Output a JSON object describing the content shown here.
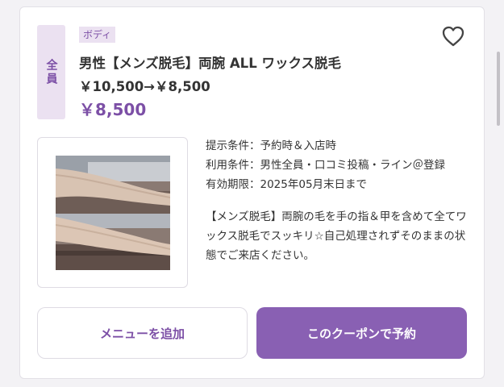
{
  "coupon": {
    "badge": "全員",
    "category": "ボディ",
    "title": "男性【メンズ脱毛】両腕 ALL ワックス脱毛￥10,500→￥8,500",
    "price": "￥8,500",
    "favorite_icon": "heart-outline-icon",
    "details": [
      {
        "label": "提示条件：",
        "value": "予約時＆入店時"
      },
      {
        "label": "利用条件：",
        "value": "男性全員・口コミ投稿・ライン＠登録"
      },
      {
        "label": "有効期限：",
        "value": "2025年05月末日まで"
      }
    ],
    "description": "【メンズ脱毛】両腕の毛を手の指＆甲を含めて全てワックス脱毛でスッキリ☆自己処理されずそのままの状態でご来店ください。"
  },
  "buttons": {
    "add_menu": "メニューを追加",
    "reserve": "このクーポンで予約"
  },
  "colors": {
    "accent": "#8960b3",
    "accent_text": "#7c4fa6",
    "badge_bg": "#ebe1f1"
  }
}
